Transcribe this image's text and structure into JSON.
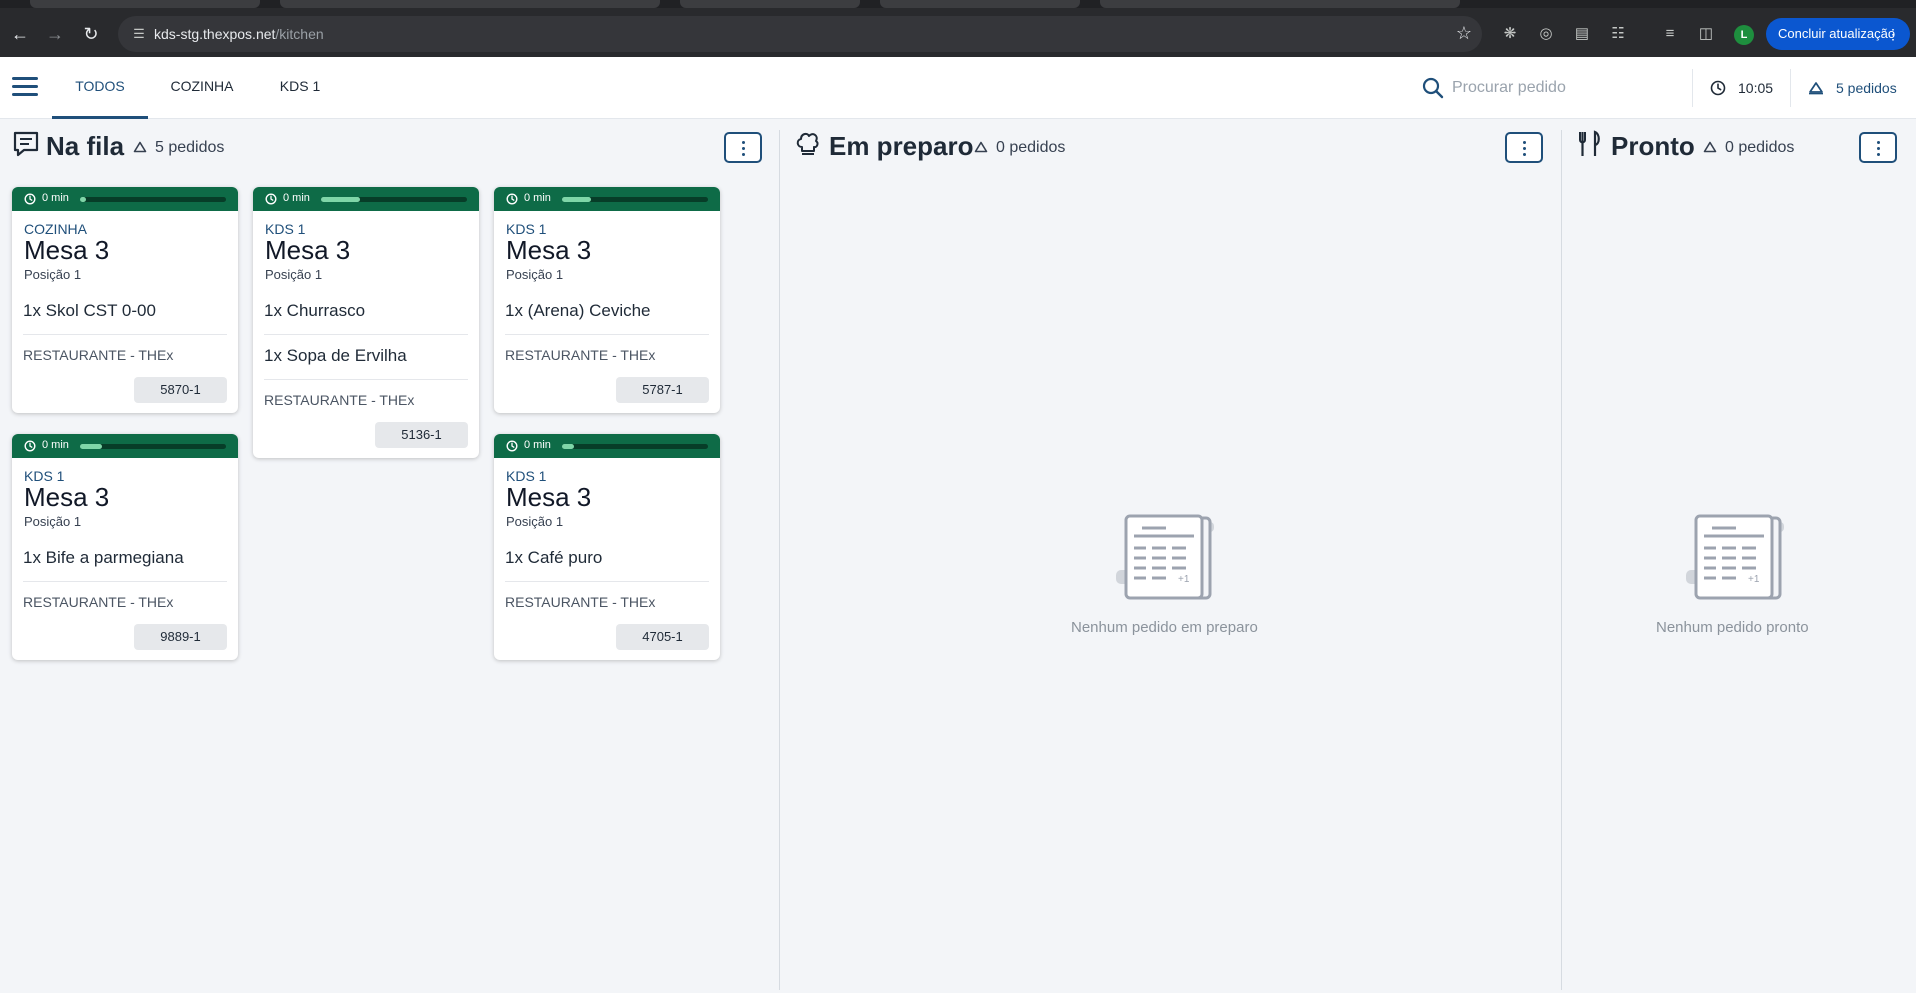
{
  "browser": {
    "url_host": "kds-stg.thexpos.net",
    "url_path": "/kitchen",
    "profile_initial": "L",
    "update_label": "Concluir atualização"
  },
  "header": {
    "tabs": [
      {
        "label": "TODOS",
        "active": true
      },
      {
        "label": "COZINHA",
        "active": false
      },
      {
        "label": "KDS 1",
        "active": false
      }
    ],
    "search_placeholder": "Procurar pedido",
    "time": "10:05",
    "order_count": "5 pedidos"
  },
  "columns": {
    "queue": {
      "title": "Na fila",
      "count": "5 pedidos"
    },
    "preparing": {
      "title": "Em preparo",
      "count": "0 pedidos",
      "empty_text": "Nenhum pedido em preparo"
    },
    "ready": {
      "title": "Pronto",
      "count": "0 pedidos",
      "empty_text": "Nenhum pedido pronto"
    }
  },
  "orders": [
    {
      "elapsed": "0 min",
      "progress": 0.03,
      "station": "COZINHA",
      "table": "Mesa 3",
      "position": "Posição 1",
      "items": [
        "1x Skol CST 0-00"
      ],
      "restaurant": "RESTAURANTE - THEx",
      "code": "5870-1"
    },
    {
      "elapsed": "0 min",
      "progress": 0.27,
      "station": "KDS 1",
      "table": "Mesa 3",
      "position": "Posição 1",
      "items": [
        "1x Churrasco",
        "1x Sopa de Ervilha"
      ],
      "restaurant": "RESTAURANTE - THEx",
      "code": "5136-1"
    },
    {
      "elapsed": "0 min",
      "progress": 0.2,
      "station": "KDS 1",
      "table": "Mesa 3",
      "position": "Posição 1",
      "items": [
        "1x (Arena) Ceviche"
      ],
      "restaurant": "RESTAURANTE - THEx",
      "code": "5787-1"
    },
    {
      "elapsed": "0 min",
      "progress": 0.15,
      "station": "KDS 1",
      "table": "Mesa 3",
      "position": "Posição 1",
      "items": [
        "1x Bife a parmegiana"
      ],
      "restaurant": "RESTAURANTE - THEx",
      "code": "9889-1"
    },
    {
      "elapsed": "0 min",
      "progress": 0.08,
      "station": "KDS 1",
      "table": "Mesa 3",
      "position": "Posição 1",
      "items": [
        "1x Café puro"
      ],
      "restaurant": "RESTAURANTE - THEx",
      "code": "4705-1"
    }
  ],
  "colors": {
    "primary": "#1f4f7a",
    "card_header": "#0e6b47",
    "progress_fill": "#7fd6a8"
  }
}
